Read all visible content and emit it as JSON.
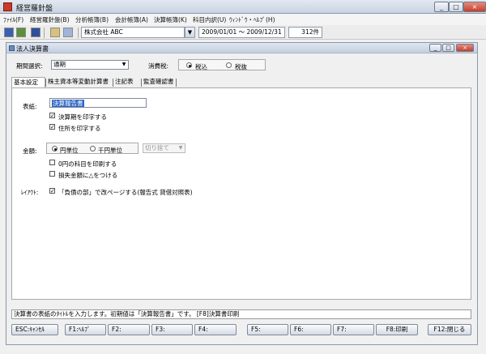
{
  "app": {
    "title": "経営羅針盤",
    "window_buttons": [
      "_",
      "□",
      "×"
    ]
  },
  "menu": [
    "ﾌｧｲﾙ(F)",
    "経営羅針盤(B)",
    "分析帳簿(B)",
    "会計帳簿(A)",
    "決算帳簿(K)",
    "科目内訳(U)",
    "ｳｨﾝﾄﾞｳ・ﾍﾙﾌﾟ(H)"
  ],
  "toolbar": {
    "company": "株式会社 ABC",
    "period": "2009/01/01 〜 2009/12/31",
    "count": "312件"
  },
  "child_window": {
    "title": "法人決算書",
    "buttons": [
      "_",
      "□",
      "×"
    ]
  },
  "form": {
    "period_label": "期間選択:",
    "period_value": "通期",
    "tax_label": "消費税:",
    "tax_options": [
      "税込",
      "税抜"
    ],
    "tax_selected": "税込"
  },
  "tabs": [
    "基本設定",
    "株主資本等変動計算書",
    "注記表",
    "監査確認書"
  ],
  "basic": {
    "cover_label": "表紙:",
    "cover_value": "決算報告書",
    "opt_print_period": "決算期を印字する",
    "opt_print_address": "住所を印字する",
    "amount_label": "金額:",
    "unit_options": [
      "円単位",
      "千円単位"
    ],
    "unit_selected": "円単位",
    "rounding_value": "切り捨て",
    "opt_print_zero": "0円の科目を印刷する",
    "opt_loss_mark": "損失金額に△をつける",
    "layout_label": "ﾚｲｱｳﾄ:",
    "opt_page_break": "「負債の部」で改ページする(報告式 貸借対照表)"
  },
  "status_text": "決算書の表紙のﾀｲﾄﾙを入力します。初期値は「決算報告書」です。 [F8]決算書印刷",
  "fkeys": [
    "ESC:ｷｬﾝｾﾙ",
    "F1:ﾍﾙﾌﾟ",
    "F2:",
    "F3:",
    "F4:",
    "F5:",
    "F6:",
    "F7:",
    "F8:印刷",
    "F12:閉じる"
  ]
}
